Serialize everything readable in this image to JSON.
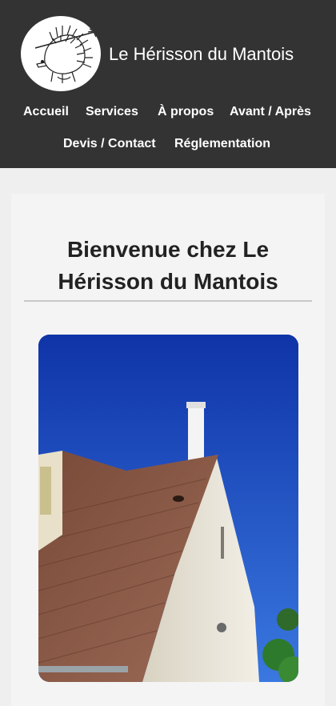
{
  "site": {
    "title": "Le Hérisson du Mantois"
  },
  "nav": {
    "items": [
      {
        "label": "Accueil"
      },
      {
        "label": "Services"
      },
      {
        "label": "À propos"
      },
      {
        "label": "Avant / Après"
      },
      {
        "label": "Devis / Contact"
      },
      {
        "label": "Réglementation"
      }
    ]
  },
  "main": {
    "heading_line1": "Bienvenue chez Le",
    "heading_line2": "Hérisson du Mantois"
  },
  "icons": {
    "logo": "hedgehog-chimney-sweep-logo"
  },
  "colors": {
    "header_bg": "#333333",
    "page_bg": "#efefef",
    "sky": "#1a3fb0",
    "text": "#222222"
  }
}
